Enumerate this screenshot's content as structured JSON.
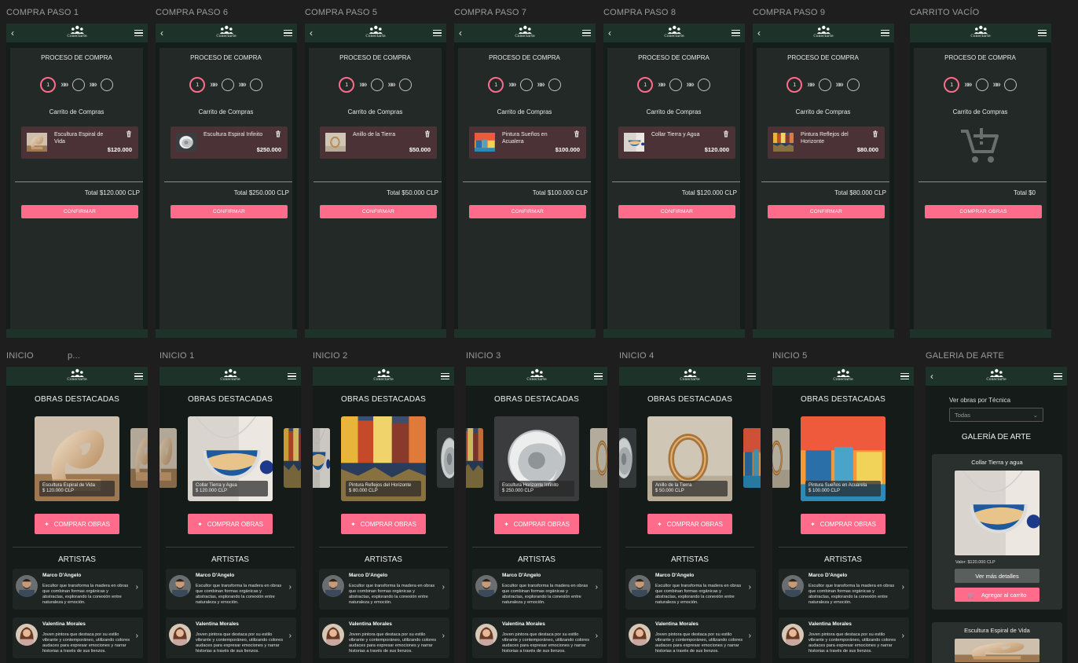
{
  "app": {
    "logo_text": "Conectarte"
  },
  "cart_frames": [
    {
      "label": "COMPRA PASO 1",
      "title": "PROCESO DE COMPRA",
      "step": "1",
      "subtitle": "Carrito de Compras",
      "item_name": "Escultura Espiral de Vida",
      "item_price": "$120.000",
      "total": "Total $120.000 CLP",
      "button": "CONFIRMAR",
      "thumb": "sculpture"
    },
    {
      "label": "COMPRA PASO 6",
      "title": "PROCESO DE COMPRA",
      "step": "1",
      "subtitle": "Carrito de Compras",
      "item_name": "Escultura Espiral Infinito",
      "item_price": "$250.000",
      "total": "Total $250.000 CLP",
      "button": "CONFIRMAR",
      "thumb": "silver"
    },
    {
      "label": "COMPRA PASO 5",
      "title": "PROCESO DE COMPRA",
      "step": "1",
      "subtitle": "Carrito de Compras",
      "item_name": "Anillo de la Tierra",
      "item_price": "$50.000",
      "total": "Total $50.000 CLP",
      "button": "CONFIRMAR",
      "thumb": "ring"
    },
    {
      "label": "COMPRA PASO 7",
      "title": "PROCESO DE COMPRA",
      "step": "1",
      "subtitle": "Carrito de Compras",
      "item_name": "Pintura Sueños en Acualera",
      "item_price": "$100.000",
      "total": "Total $100.000 CLP",
      "button": "CONFIRMAR",
      "thumb": "painting"
    },
    {
      "label": "COMPRA PASO 8",
      "title": "PROCESO DE COMPRA",
      "step": "1",
      "subtitle": "Carrito de Compras",
      "item_name": "Collar Tierra y Agua",
      "item_price": "$120.000",
      "total": "Total $120.000 CLP",
      "button": "CONFIRMAR",
      "thumb": "necklace"
    },
    {
      "label": "COMPRA PASO 9",
      "title": "PROCESO DE COMPRA",
      "step": "1",
      "subtitle": "Carrito de Compras",
      "item_name": "Pintura Reflejos del Horizonte",
      "item_price": "$80.000",
      "total": "Total $80.000 CLP",
      "button": "CONFIRMAR",
      "thumb": "reflections"
    }
  ],
  "empty_cart": {
    "label": "CARRITO VACÍO",
    "title": "PROCESO DE COMPRA",
    "step": "1",
    "subtitle": "Carrito de Compras",
    "total": "Total $0",
    "button": "COMPRAR OBRAS"
  },
  "home_frames": [
    {
      "label": "INICIO",
      "label2": "p...",
      "caption_name": "Escultura Espiral de Vida",
      "caption_price": "$ 120.000 CLP",
      "main": "sculpture",
      "left": "",
      "right": "sculpture"
    },
    {
      "label": "INICIO 1",
      "caption_name": "Collar Tierra y Agua",
      "caption_price": "$ 120.000 CLP",
      "main": "necklace",
      "left": "sculpture",
      "right": "reflections"
    },
    {
      "label": "INICIO 2",
      "caption_name": "Pintura Reflejos del Horizonte",
      "caption_price": "$ 80.000 CLP",
      "main": "reflections",
      "left": "necklace",
      "right": "silver"
    },
    {
      "label": "INICIO 3",
      "caption_name": "Escultura Horizonte Infinito",
      "caption_price": "$ 250.000 CLP",
      "main": "silver",
      "left": "reflections",
      "right": "ring"
    },
    {
      "label": "INICIO 4",
      "caption_name": "Anillo de la Tierra",
      "caption_price": "$ 50.000 CLP",
      "main": "ring",
      "left": "silver",
      "right": "painting"
    },
    {
      "label": "INICIO 5",
      "caption_name": "Pintura Sueños en Acuarela",
      "caption_price": "$ 100.000 CLP",
      "main": "painting",
      "left": "ring",
      "right": ""
    }
  ],
  "home": {
    "featured_title": "OBRAS DESTACADAS",
    "buy_button": "COMPRAR OBRAS",
    "artists_title": "ARTISTAS",
    "artists": [
      {
        "name": "Marco D'Angelo",
        "desc": "Escultor que transforma la madera en obras que combinan formas orgánicas y abstractas, explorando la conexión entre naturaleza y emoción."
      },
      {
        "name": "Valentina Morales",
        "desc": "Joven pintora que destaca por su estilo vibrante y contemporáneo, utilizando colores audaces para expresar emociones y narrar historias a través de sus lienzos."
      }
    ]
  },
  "gallery": {
    "label": "GALERIA DE ARTE",
    "filter_label": "Ver obras por Técnica",
    "filter_value": "Todas",
    "title": "GALERÍA DE ARTE",
    "cards": [
      {
        "name": "Collar Tierra y agua",
        "value": "Valor: $120.000 CLP",
        "details": "Ver más detalles",
        "add": "Agregar al carrito"
      },
      {
        "name": "Escultura Espiral de Vida"
      }
    ]
  },
  "colors": {
    "accent": "#ff6b8a",
    "appbar": "#1d3329",
    "panel": "#222927",
    "item": "#4a3236"
  }
}
